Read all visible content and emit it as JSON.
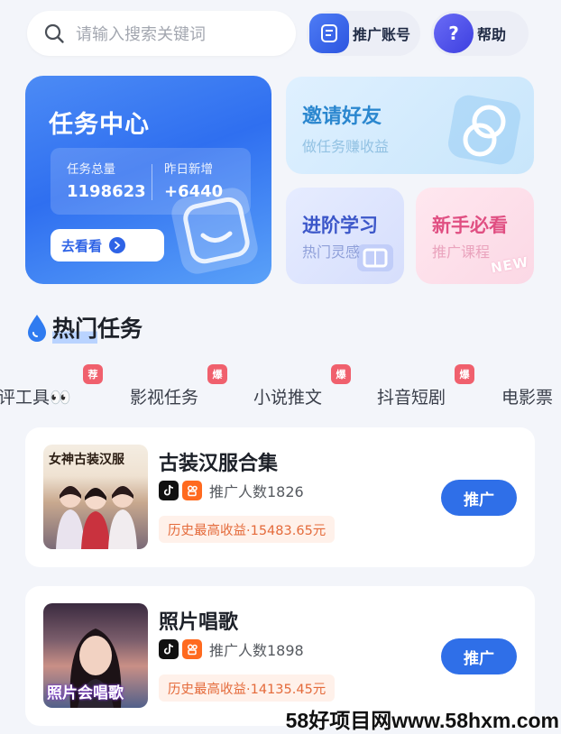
{
  "search": {
    "placeholder": "请输入搜索关键词",
    "icon": "search-icon"
  },
  "header": {
    "account_label": "推广账号",
    "help_label": "帮助"
  },
  "task_center": {
    "title": "任务中心",
    "total_label": "任务总量",
    "total_value": "1198623",
    "new_label": "昨日新增",
    "new_value": "+6440",
    "button_label": "去看看"
  },
  "invite": {
    "title": "邀请好友",
    "subtitle": "做任务赚收益"
  },
  "study": {
    "title": "进阶学习",
    "subtitle": "热门灵感"
  },
  "newbie": {
    "title": "新手必看",
    "subtitle": "推广课程",
    "tag": "NEW"
  },
  "hot": {
    "title_highlight": "热门",
    "title_rest": "任务",
    "tabs": [
      {
        "label": "评工具👀",
        "badge": "荐"
      },
      {
        "label": "影视任务",
        "badge": "爆"
      },
      {
        "label": "小说推文",
        "badge": "爆"
      },
      {
        "label": "抖音短剧",
        "badge": "爆"
      },
      {
        "label": "电影票",
        "badge": ""
      }
    ]
  },
  "tasks": [
    {
      "name": "古装汉服合集",
      "thumb_caption": "女神古装汉服",
      "count": "推广人数1826",
      "earnings": "历史最高收益·15483.65元",
      "button": "推广"
    },
    {
      "name": "照片唱歌",
      "thumb_caption": "照片会唱歌",
      "count": "推广人数1898",
      "earnings": "历史最高收益·14135.45元",
      "button": "推广"
    }
  ],
  "watermark": "58好项目网www.58hxm.com",
  "colors": {
    "accent": "#2f6fe8",
    "badge": "#f0606d",
    "earn_text": "#e46a3a",
    "invite_title": "#2b87cf",
    "newbie_title": "#e04f82"
  }
}
